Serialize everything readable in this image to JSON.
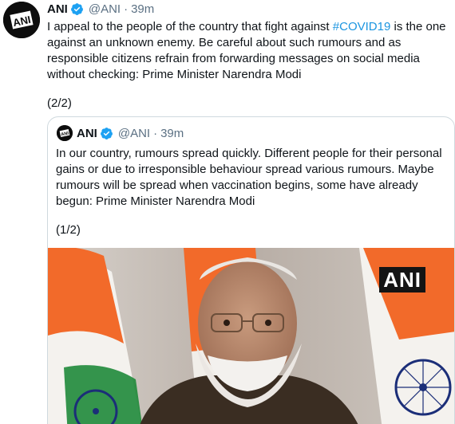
{
  "tweet": {
    "avatar_label": "ANI",
    "name": "ANI",
    "handle": "@ANI",
    "separator": "·",
    "time": "39m",
    "text_before": "I appeal to the people of the country that fight against ",
    "hashtag": "#COVID19",
    "text_after": " is the one against an unknown enemy. Be careful about such rumours and as responsible citizens refrain from forwarding messages on social media without checking: Prime Minister Narendra Modi",
    "part": "(2/2)"
  },
  "quoted_tweet": {
    "avatar_label": "ANI",
    "name": "ANI",
    "handle": "@ANI",
    "separator": "·",
    "time": "39m",
    "text": "In our country, rumours spread quickly. Different people for their personal gains or due to irresponsible behaviour spread various rumours. Maybe rumours will be spread when vaccination begins, some have already begun: Prime Minister Narendra Modi",
    "part": "(1/2)",
    "media": {
      "watermark": "ANI",
      "description_icon": "video-frame-image"
    }
  },
  "colors": {
    "text": "#0f1419",
    "secondary": "#5b7083",
    "hashtag": "#1b95e0",
    "verified": "#1da1f2",
    "border": "#cfd9de",
    "saffron": "#f26a2a",
    "green": "#1f8a3a",
    "chakra": "#1b2e78"
  }
}
